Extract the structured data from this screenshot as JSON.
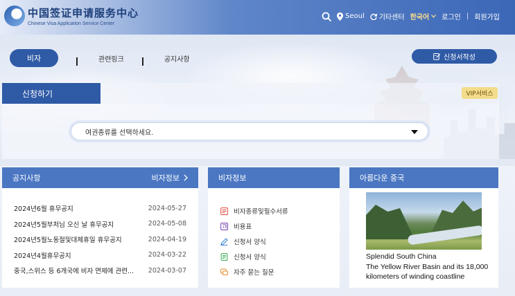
{
  "header": {
    "logo_cn": "中国签证申请服务中心",
    "logo_en": "Chinese Visa Application Service Center",
    "location": "Seoul",
    "other_center": "기타센터",
    "language": "한국어",
    "login": "로그인",
    "separator": "|",
    "signup": "회원가입"
  },
  "nav": {
    "visa": "비자",
    "related_links": "관련링크",
    "notices": "공지사항",
    "apply_form_button": "신청서작성"
  },
  "apply": {
    "tab_label": "신청하기",
    "vip_label": "VIP서비스",
    "passport_placeholder": "여권종류를 선택하세요."
  },
  "notice_panel": {
    "title": "공지사항",
    "more_label": "비자정보",
    "items": [
      {
        "title": "2024년6월 휴무공지",
        "date": "2024-05-27"
      },
      {
        "title": "2024년5월부처님 오신 날 휴무공지",
        "date": "2024-05-08"
      },
      {
        "title": "2024년5월노동절및대체휴일 휴무공지",
        "date": "2024-04-19"
      },
      {
        "title": "2024년4월휴무공지",
        "date": "2024-03-22"
      },
      {
        "title": "중국,스위스 등 6개국에 비자 면제에 관련...",
        "date": "2024-03-07"
      }
    ]
  },
  "visa_panel": {
    "title": "비자정보",
    "items": [
      {
        "label": "비자종류및필수서류",
        "icon": "document-list-icon",
        "color": "#e0584d"
      },
      {
        "label": "비용표",
        "icon": "price-tag-icon",
        "color": "#7b4bb5"
      },
      {
        "label": "신청서 양식",
        "icon": "pencil-edit-icon",
        "color": "#3a86d6"
      },
      {
        "label": "신청서 양식",
        "icon": "form-document-icon",
        "color": "#3fae5a"
      },
      {
        "label": "자주 묻는 질문",
        "icon": "faq-chat-icon",
        "color": "#e88a2e"
      }
    ]
  },
  "china_panel": {
    "title": "아름다운 중국",
    "caption_line1": "Splendid South China",
    "caption_line2": "The Yellow River Basin and its 18,000 kilometers of winding coastline"
  },
  "colors": {
    "primary": "#2f5aa6",
    "panel_header": "#4b77c2",
    "language_highlight": "#ffe08a",
    "vip": "#f3dc8a"
  }
}
